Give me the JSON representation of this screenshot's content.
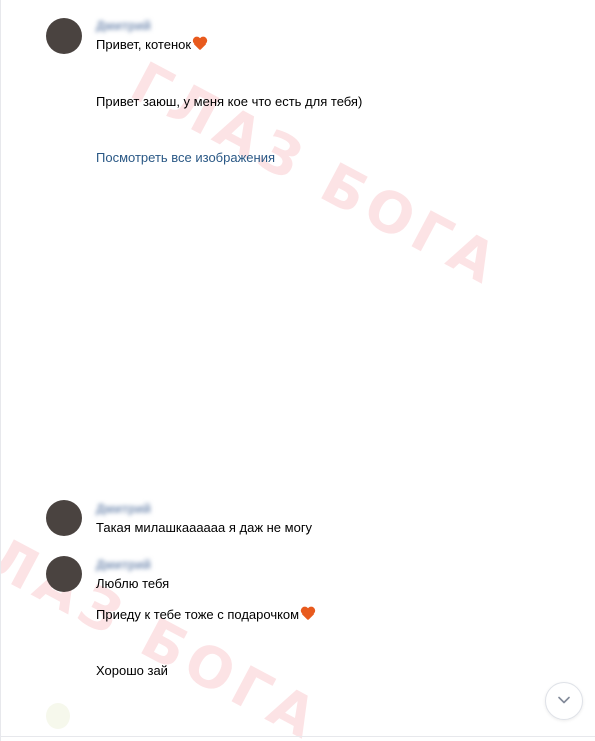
{
  "watermark": {
    "text": "ГЛАЗ БОГА"
  },
  "messages": [
    {
      "sender": "Дмитрий",
      "lines": [
        "Привет, котенок"
      ],
      "emoji_after_first_line": "orange-heart"
    },
    {
      "lines": [
        "Привет заюш, у меня кое что есть для тебя)"
      ]
    },
    {
      "link": "Посмотреть все изображения"
    },
    {
      "sender": "Дмитрий",
      "lines": [
        "Такая милашкаааааа я даж не могу"
      ]
    },
    {
      "sender": "Дмитрий",
      "lines": [
        "Люблю тебя"
      ]
    },
    {
      "lines": [
        "Приеду к тебе тоже с подарочком"
      ],
      "emoji_after_first_line": "orange-heart"
    },
    {
      "lines": [
        "Хорошо зай"
      ]
    }
  ],
  "scroll_button": {
    "icon": "chevron-down-icon"
  },
  "colors": {
    "link": "#2a5885",
    "sender_name": "#7b92b5",
    "watermark": "#eb3c46",
    "heart": "#e85a1d"
  }
}
